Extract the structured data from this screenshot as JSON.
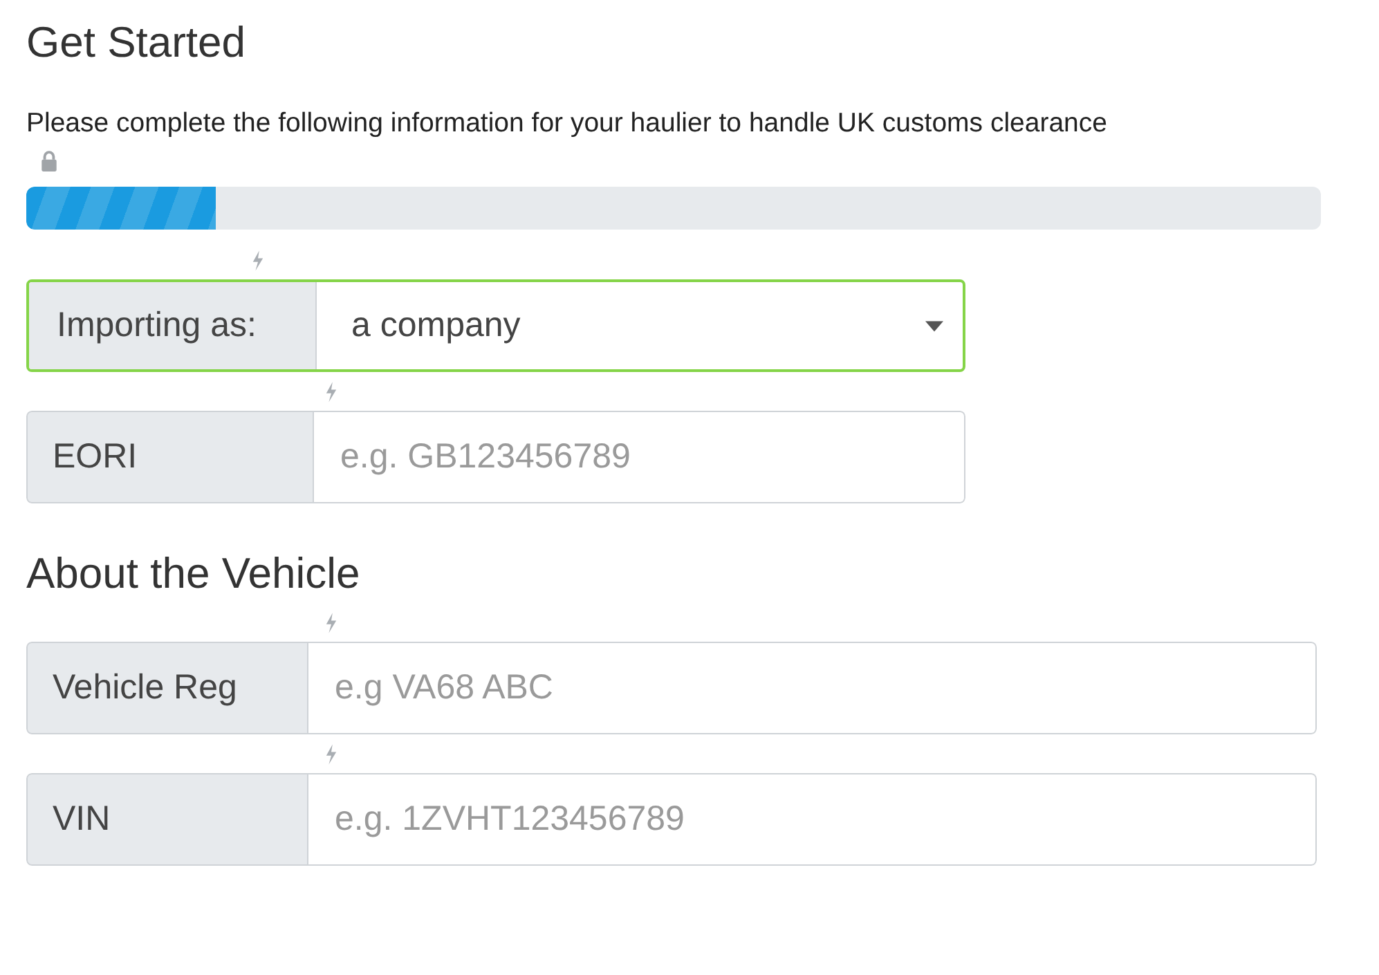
{
  "sections": [
    {
      "title": "Get Started",
      "description": "Please complete the following information for your haulier to handle UK customs clearance",
      "progress": {
        "locked": true,
        "level": 0.146
      },
      "fields": [
        {
          "kind": "select",
          "label": "Importing as:",
          "value": "a company",
          "focused": true
        },
        {
          "kind": "text",
          "label": "EORI",
          "placeholder": "e.g. GB123456789",
          "focused": false
        }
      ]
    },
    {
      "title": "About the Vehicle",
      "fields": [
        {
          "kind": "text",
          "label": "Vehicle Reg",
          "placeholder": "e.g VA68 ABC",
          "focused": false
        },
        {
          "kind": "text",
          "label": "VIN",
          "placeholder": "e.g. 1ZVHT123456789",
          "focused": false
        }
      ]
    }
  ]
}
